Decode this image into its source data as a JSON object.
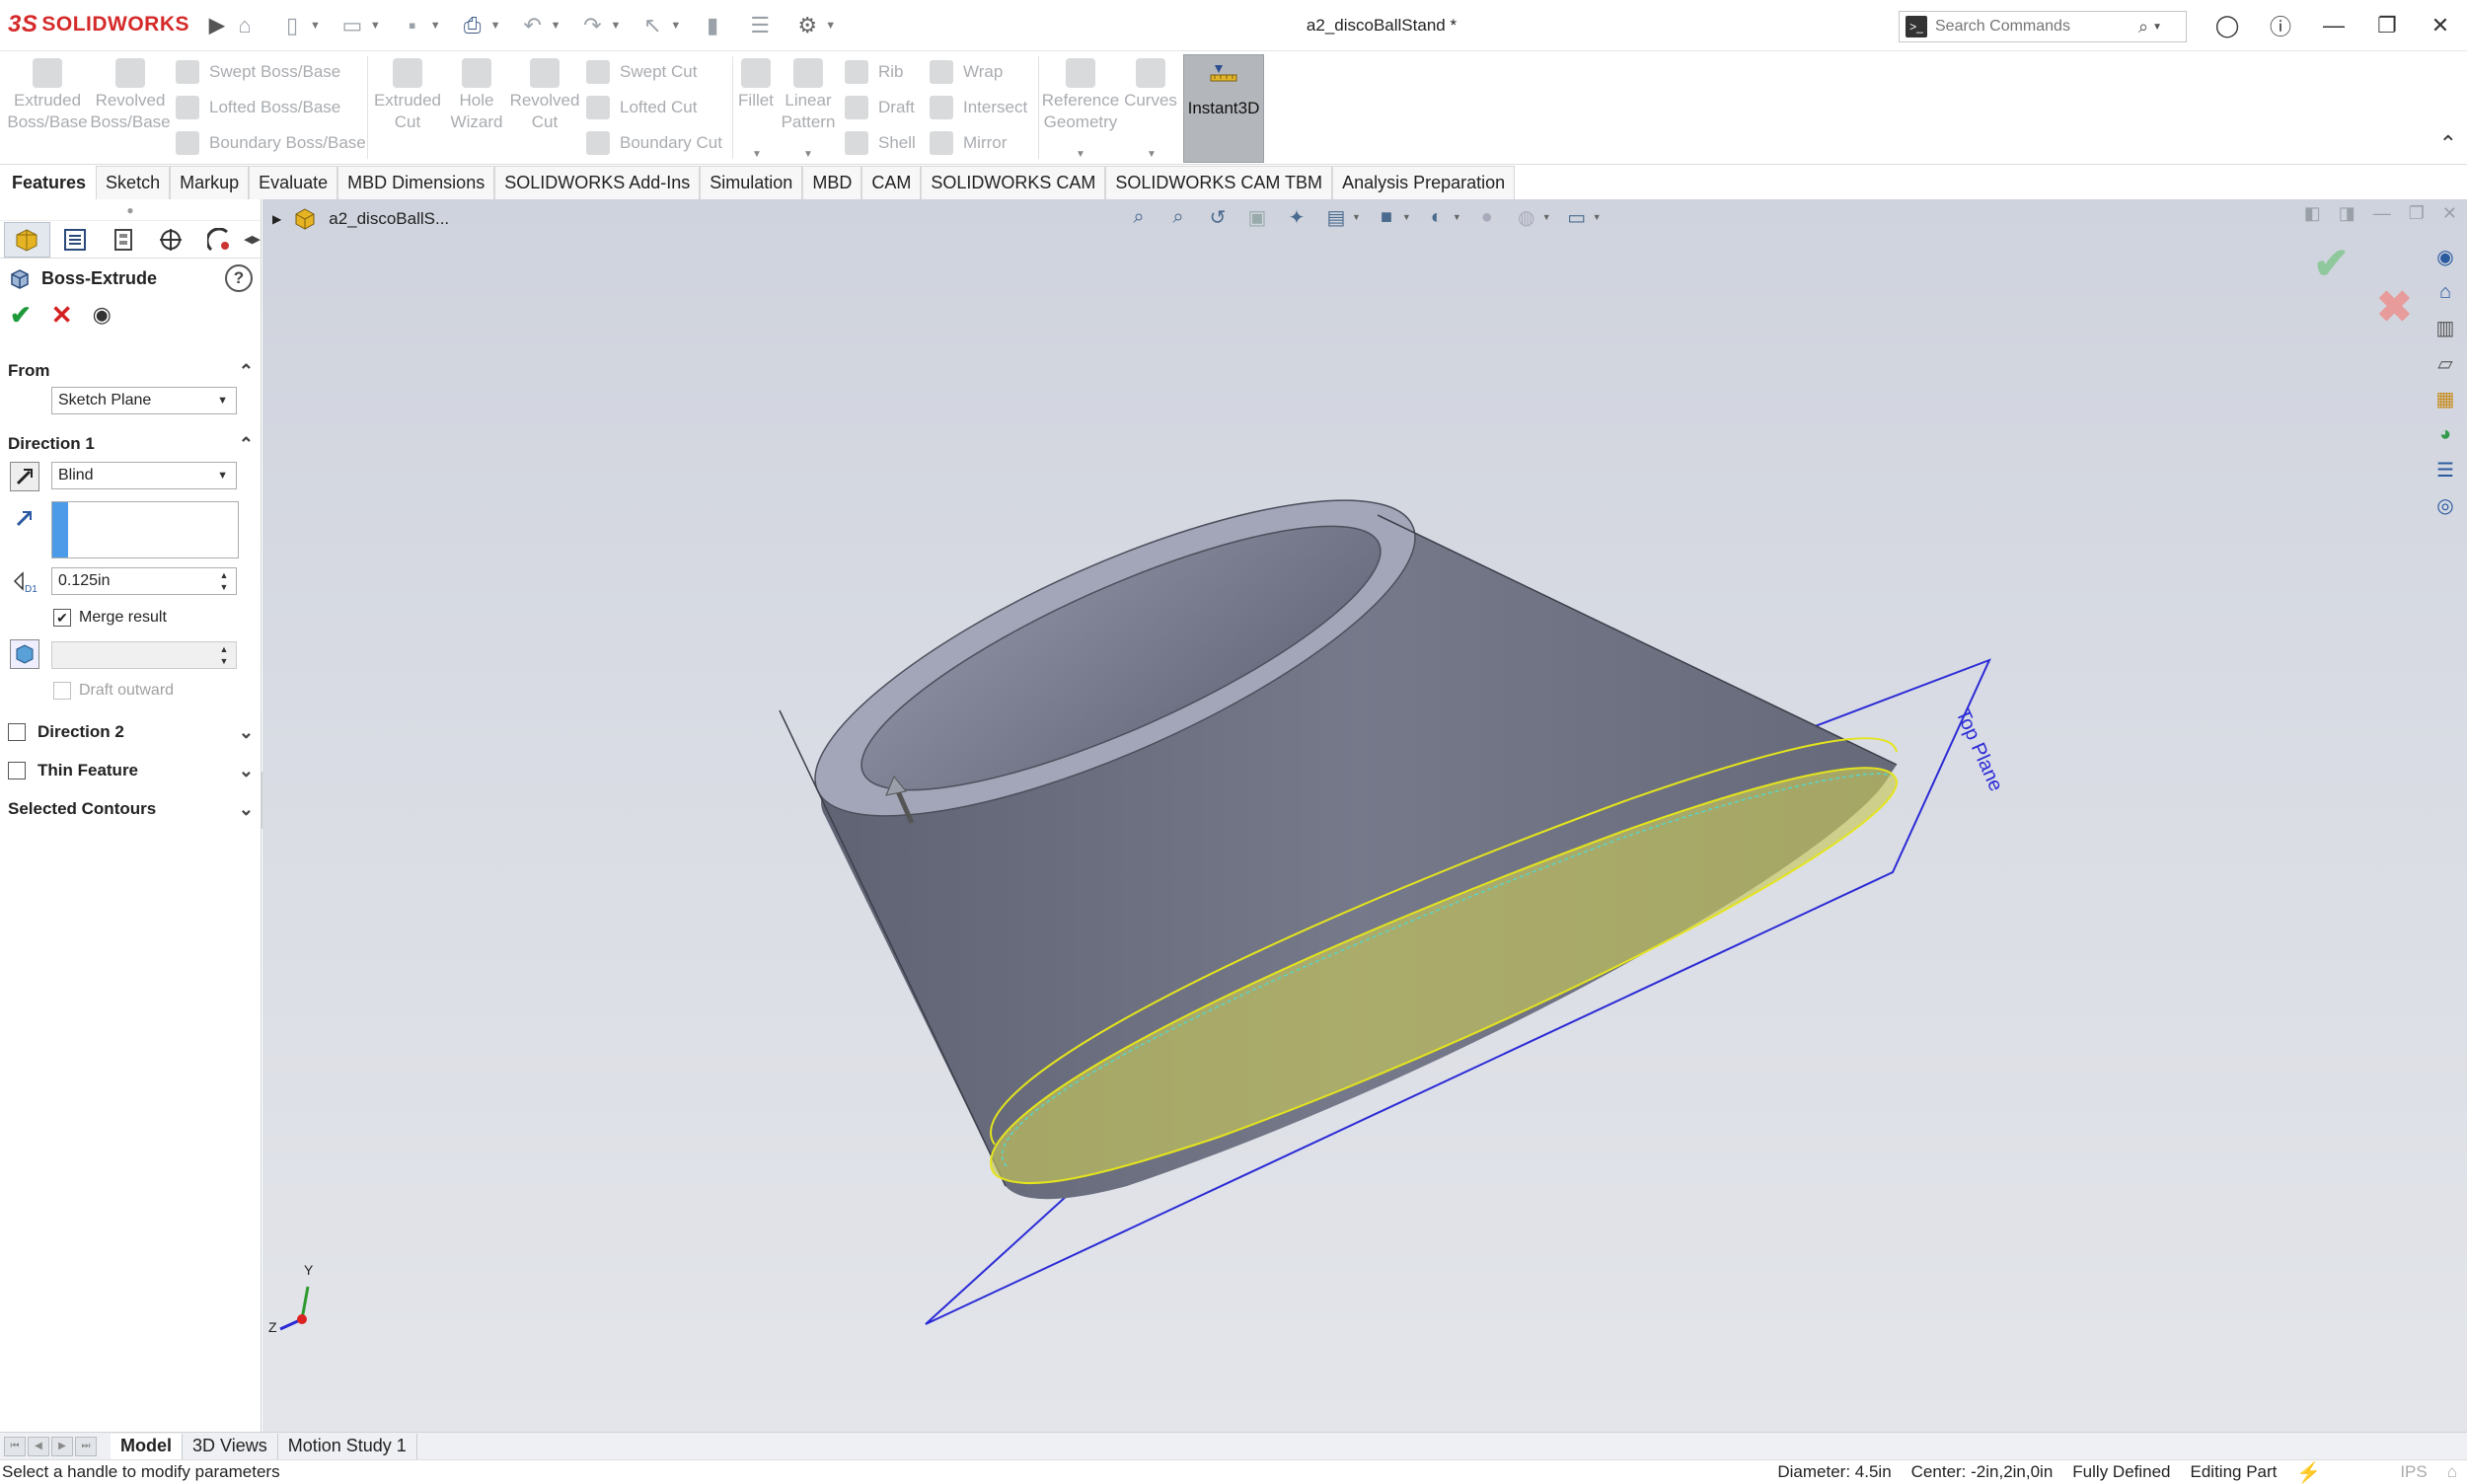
{
  "app": {
    "brand_prefix": "3S",
    "brand": "SOLIDWORKS",
    "document_title": "a2_discoBallStand *"
  },
  "search": {
    "placeholder": "Search Commands"
  },
  "ribbon": {
    "extruded_boss": "Extruded\nBoss/Base",
    "revolved_boss": "Revolved\nBoss/Base",
    "swept_boss": "Swept Boss/Base",
    "lofted_boss": "Lofted Boss/Base",
    "boundary_boss": "Boundary Boss/Base",
    "extruded_cut": "Extruded\nCut",
    "hole_wizard": "Hole\nWizard",
    "revolved_cut": "Revolved\nCut",
    "swept_cut": "Swept Cut",
    "lofted_cut": "Lofted Cut",
    "boundary_cut": "Boundary Cut",
    "fillet": "Fillet",
    "linear_pattern": "Linear\nPattern",
    "rib": "Rib",
    "draft": "Draft",
    "shell": "Shell",
    "wrap": "Wrap",
    "intersect": "Intersect",
    "mirror": "Mirror",
    "reference_geometry": "Reference\nGeometry",
    "curves": "Curves",
    "instant3d": "Instant3D"
  },
  "command_tabs": [
    "Features",
    "Sketch",
    "Markup",
    "Evaluate",
    "MBD Dimensions",
    "SOLIDWORKS Add-Ins",
    "Simulation",
    "MBD",
    "CAM",
    "SOLIDWORKS CAM",
    "SOLIDWORKS CAM TBM",
    "Analysis Preparation"
  ],
  "property_manager": {
    "title": "Boss-Extrude",
    "from": {
      "label": "From",
      "value": "Sketch Plane"
    },
    "direction1": {
      "label": "Direction 1",
      "end_condition": "Blind",
      "depth": "0.125in",
      "merge_result": "Merge result",
      "merge_checked": true,
      "draft_outward": "Draft outward",
      "draft_outward_checked": false
    },
    "direction2": "Direction 2",
    "thin_feature": "Thin Feature",
    "selected_contours": "Selected Contours"
  },
  "viewport": {
    "tree_item": "a2_discoBallS...",
    "plane_label": "Top Plane",
    "triad": {
      "y": "Y",
      "z": "Z"
    }
  },
  "bottom_tabs": [
    "Model",
    "3D Views",
    "Motion Study 1"
  ],
  "status": {
    "hint": "Select a handle to modify parameters",
    "diameter": "Diameter: 4.5in",
    "center": "Center: -2in,2in,0in",
    "defined": "Fully Defined",
    "mode": "Editing Part",
    "units": "IPS"
  },
  "colors": {
    "accent_red": "#d52a2a",
    "ok_green": "#1f9a3a",
    "cancel_red": "#d32020",
    "plane_blue": "#2b2bd6",
    "highlight_yellow": "#e4e41e"
  }
}
